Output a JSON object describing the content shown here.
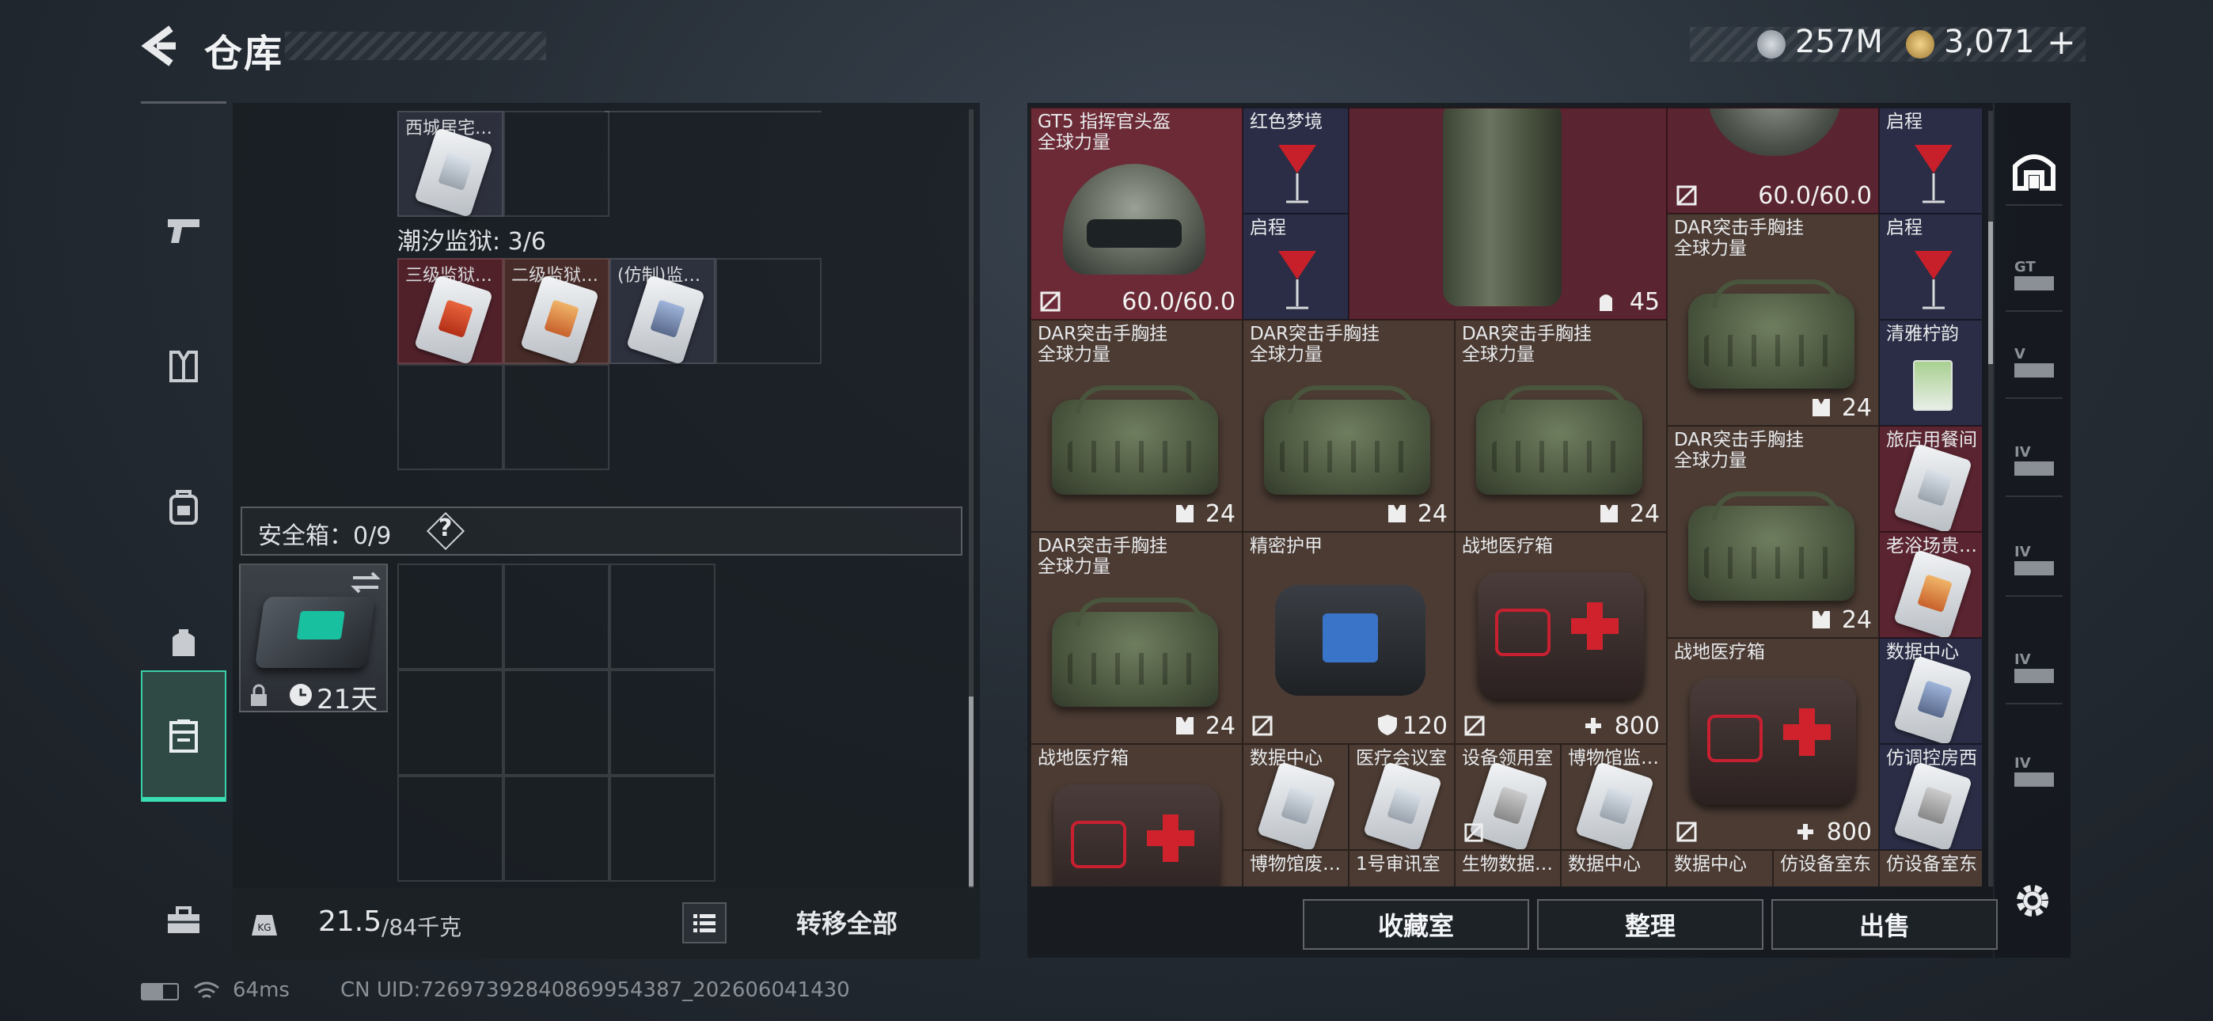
{
  "header": {
    "title": "仓库",
    "currency1": "257M",
    "currency2": "3,071",
    "plus": "+"
  },
  "nav": {
    "items": [
      {
        "name": "weapon-icon"
      },
      {
        "name": "vest-icon"
      },
      {
        "name": "backpack-icon"
      },
      {
        "name": "pouch-icon"
      },
      {
        "name": "storage-icon"
      },
      {
        "name": "toolbox-icon"
      }
    ],
    "active_index": 4
  },
  "left": {
    "top_card_label": "西城居宅…",
    "prison_title": "潮汐监狱: 3/6",
    "prison_cards": [
      "三级监狱…",
      "二级监狱…",
      "(仿制)监…"
    ],
    "safe_title": "安全箱：0/9",
    "safe_help": "?",
    "case_days": "21天",
    "weight_current": "21.5",
    "weight_max": "/84千克",
    "transfer_all": "转移全部"
  },
  "right": {
    "items": {
      "helmet1_name": "GT5 指挥官头盔",
      "helmet1_sub": "全球力量",
      "helmet1_dur": "60.0/60.0",
      "redDream": "红色梦境",
      "qicheng1": "启程",
      "qicheng2": "启程",
      "vest_count": "45",
      "helmet2_dur": "60.0/60.0",
      "qicheng3": "启程",
      "qicheng4": "启程",
      "dar_name": "DAR突击手胸挂",
      "dar_sub": "全球力量",
      "dar_count": "24",
      "lemon": "清雅柠韵",
      "hotel": "旅店用餐间",
      "bath": "老浴场贵…",
      "armor_name": "精密护甲",
      "armor_val": "120",
      "medkit_name": "战地医疗箱",
      "medkit_val": "800",
      "datacenter": "数据中心",
      "medroom": "医疗会议室",
      "equiproom": "设备领用室",
      "museum": "博物馆监…",
      "fangtiao": "仿调控房西",
      "museum2": "博物馆废…",
      "comm1": "1号审讯室",
      "bio": "生物数据…",
      "datacenter2": "数据中心",
      "datacenter3": "数据中心",
      "fangshe1": "仿设备室东",
      "fangshe2": "仿设备室东"
    },
    "buttons": {
      "collection": "收藏室",
      "sort": "整理",
      "sell": "出售"
    }
  },
  "status": {
    "ping": "64ms",
    "uid": "CN UID:7269739284086995438​7_202606041430"
  },
  "colors": {
    "accent": "#3ae0b4",
    "red_item": "#6b2a35",
    "brown_item": "#4b3b33"
  }
}
